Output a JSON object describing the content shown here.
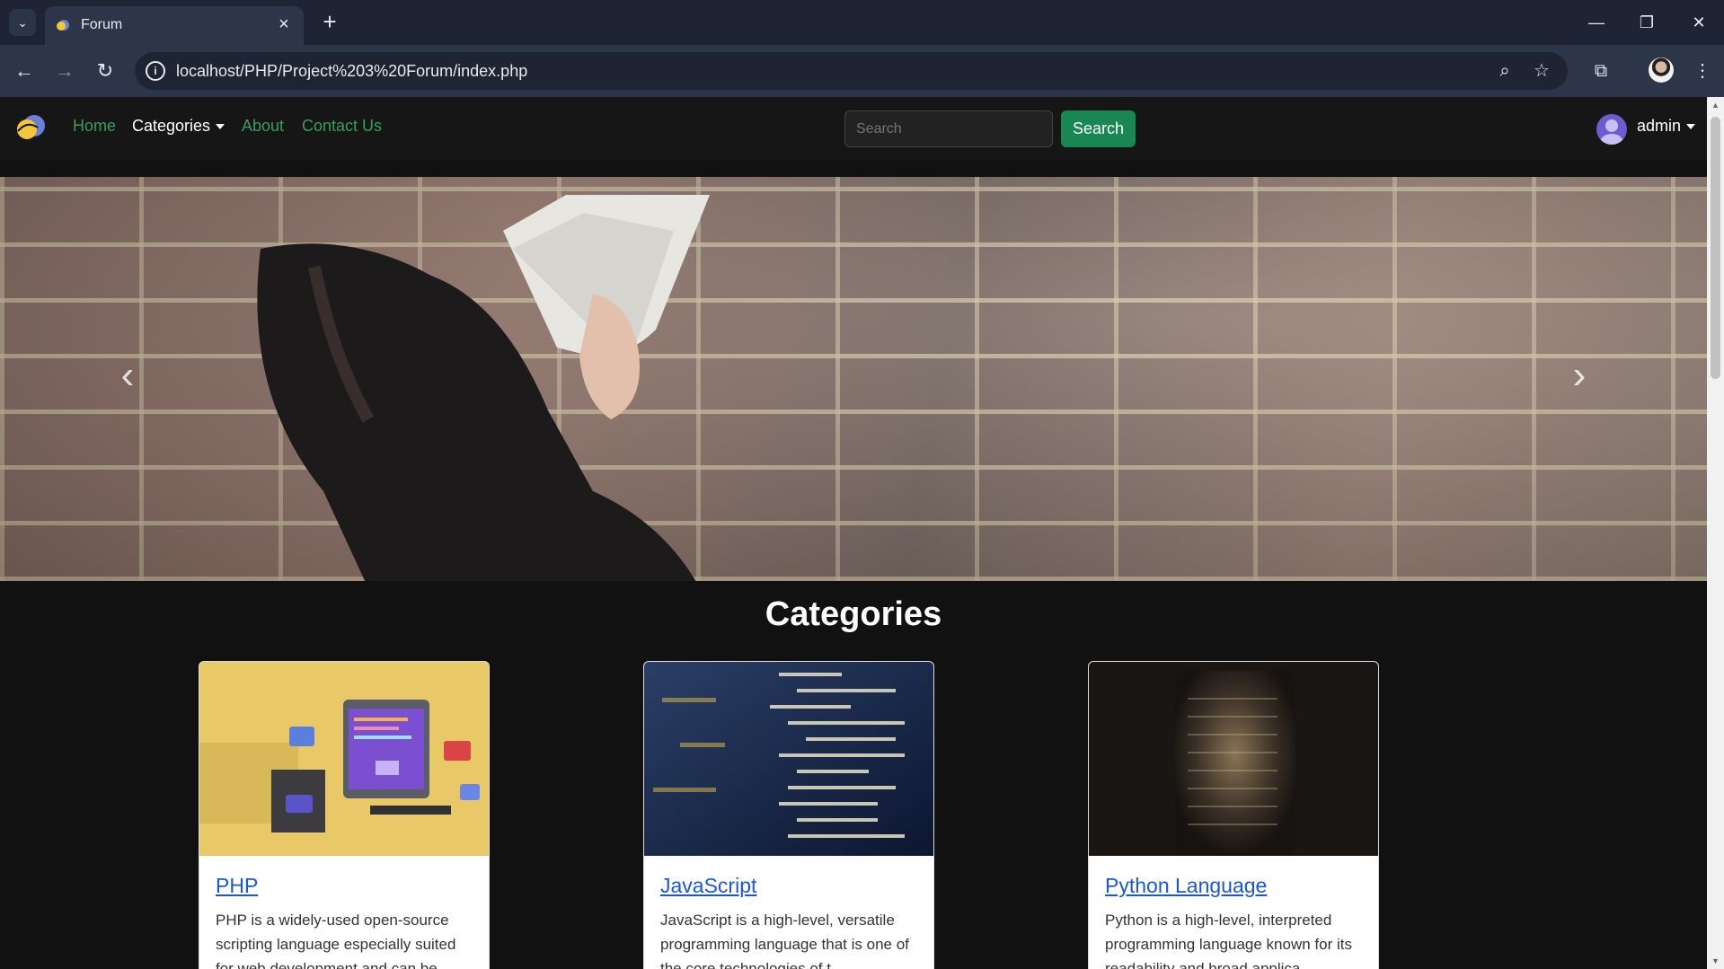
{
  "browser": {
    "tab_title": "Forum",
    "url": "localhost/PHP/Project%203%20Forum/index.php",
    "tab_close": "×",
    "new_tab": "+"
  },
  "navbar": {
    "links": [
      "Home",
      "Categories",
      "About",
      "Contact Us"
    ],
    "search_placeholder": "Search",
    "search_button": "Search",
    "user": "admin"
  },
  "carousel": {
    "prev": "‹",
    "next": "›"
  },
  "categories": {
    "title": "Categories",
    "cards": [
      {
        "title": "PHP",
        "text": "PHP is a widely-used open-source scripting language especially suited for web development and can be"
      },
      {
        "title": "JavaScript",
        "text": "JavaScript is a high-level, versatile programming language that is one of the core technologies of t"
      },
      {
        "title": "Python Language",
        "text": "Python is a high-level, interpreted programming language known for its readability and broad applica"
      }
    ]
  },
  "colors": {
    "accent_green": "#198754",
    "link_green": "#3a9d5d",
    "card_link": "#1a56db",
    "page_bg": "#111111"
  }
}
